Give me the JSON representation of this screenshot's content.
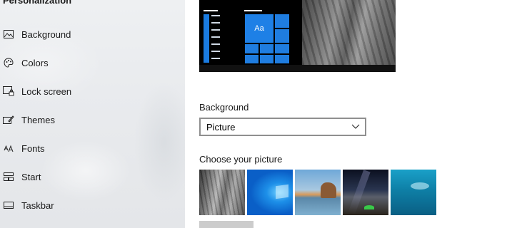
{
  "sidebar": {
    "header": "Personalization",
    "items": [
      {
        "label": "Background",
        "icon": "picture-icon"
      },
      {
        "label": "Colors",
        "icon": "palette-icon"
      },
      {
        "label": "Lock screen",
        "icon": "lock-screen-icon"
      },
      {
        "label": "Themes",
        "icon": "themes-brush-icon"
      },
      {
        "label": "Fonts",
        "icon": "fonts-icon"
      },
      {
        "label": "Start",
        "icon": "start-icon"
      },
      {
        "label": "Taskbar",
        "icon": "taskbar-icon"
      }
    ]
  },
  "main": {
    "preview": {
      "tile_label": "Aa"
    },
    "background": {
      "label": "Background",
      "selected": "Picture"
    },
    "choose_picture": {
      "label": "Choose your picture",
      "thumbnails": [
        "rock-face-thumbnail",
        "windows-blue-thumbnail",
        "beach-rock-thumbnail",
        "night-sky-tent-thumbnail",
        "underwater-thumbnail"
      ]
    }
  },
  "colors": {
    "accent": "#0078d7",
    "sidebar_bg": "#e9ebee"
  }
}
